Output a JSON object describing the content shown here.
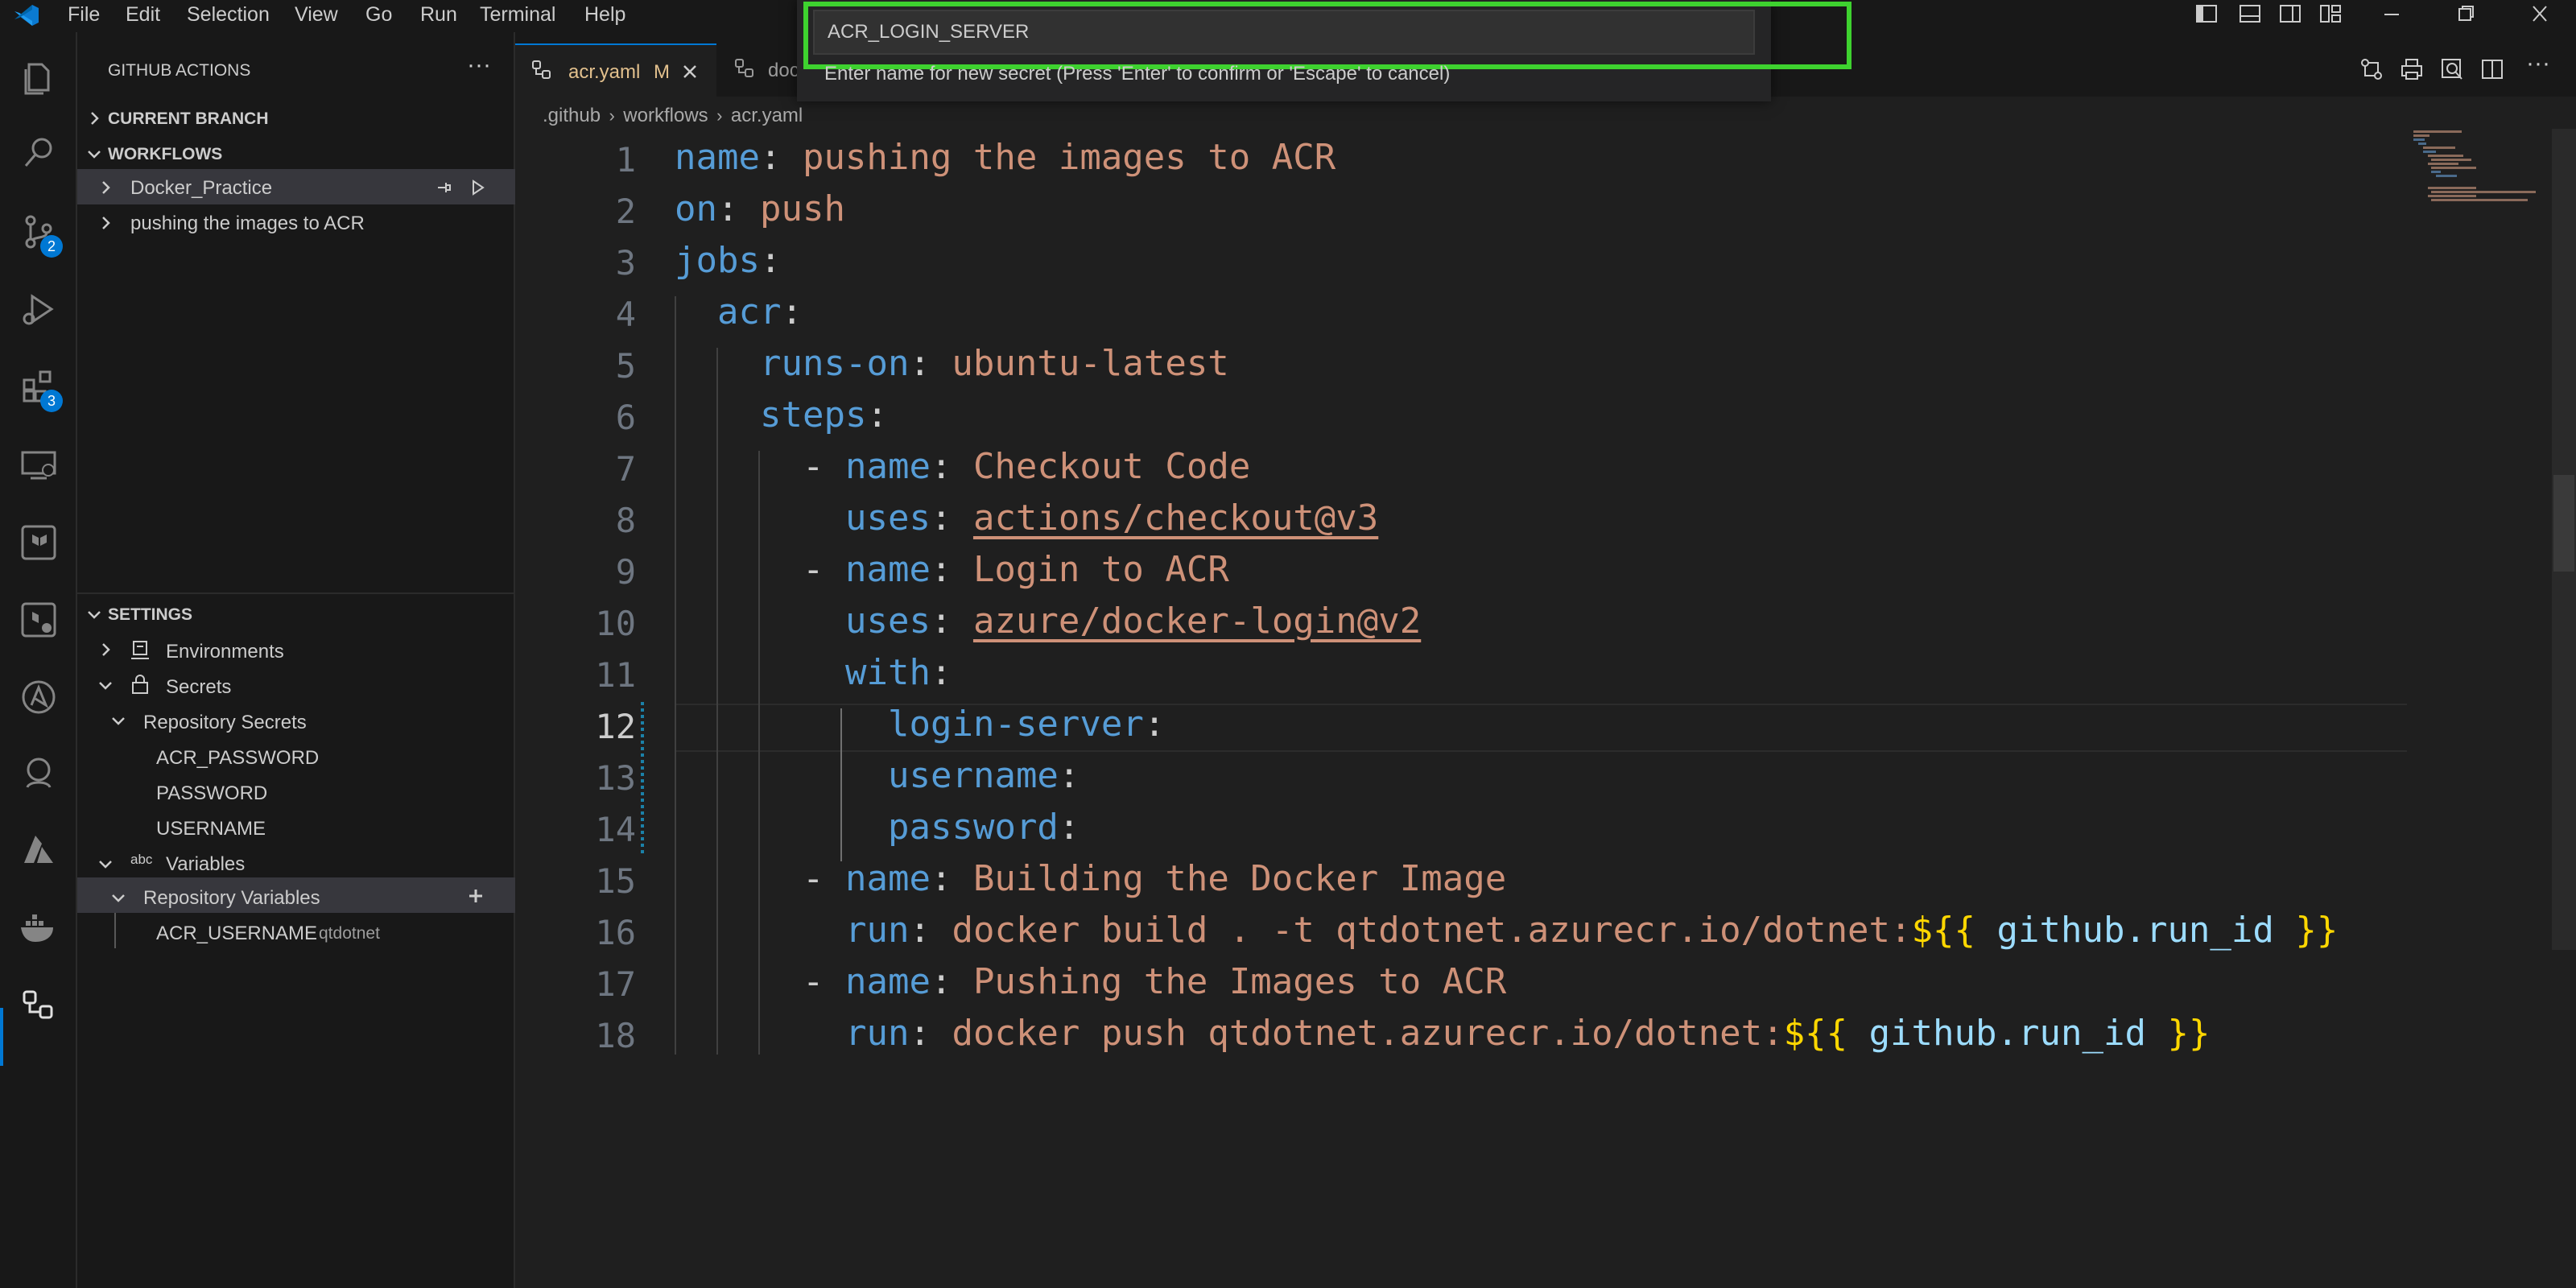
{
  "menu": [
    "File",
    "Edit",
    "Selection",
    "View",
    "Go",
    "Run",
    "Terminal",
    "Help"
  ],
  "quick_input": {
    "value": "ACR_LOGIN_SERVER",
    "message": "Enter name for new secret (Press 'Enter' to confirm or 'Escape' to cancel)"
  },
  "activity_badges": {
    "source_control": "2",
    "extensions": "3"
  },
  "sidebar": {
    "title": "GITHUB ACTIONS",
    "current_branch": "CURRENT BRANCH",
    "workflows_header": "WORKFLOWS",
    "workflows": [
      "Docker_Practice",
      "pushing the images to ACR"
    ],
    "settings_header": "SETTINGS",
    "environments": "Environments",
    "secrets": "Secrets",
    "repo_secrets": "Repository Secrets",
    "secret_items": [
      "ACR_PASSWORD",
      "PASSWORD",
      "USERNAME"
    ],
    "variables": "Variables",
    "repo_variables": "Repository Variables",
    "variable_name": "ACR_USERNAME",
    "variable_value": "qtdotnet"
  },
  "tabs": {
    "active_label": "acr.yaml",
    "active_status": "M",
    "second_label": "doc"
  },
  "breadcrumb": [
    ".github",
    "workflows",
    "acr.yaml"
  ],
  "code": {
    "l1_key": "name",
    "l1_val": "pushing the images to ACR",
    "l2_key": "on",
    "l2_val": "push",
    "l3_key": "jobs",
    "l4_key": "acr",
    "l5_key": "runs-on",
    "l5_val": "ubuntu-latest",
    "l6_key": "steps",
    "l7_key": "name",
    "l7_val": "Checkout Code",
    "l8_key": "uses",
    "l8_val": "actions/checkout@v3",
    "l9_key": "name",
    "l9_val": "Login to ACR",
    "l10_key": "uses",
    "l10_val": "azure/docker-login@v2",
    "l11_key": "with",
    "l12_key": "login-server",
    "l13_key": "username",
    "l14_key": "password",
    "l15_key": "name",
    "l15_val": "Building the Docker Image",
    "l16_key": "run",
    "l16_val": "docker build . -t qtdotnet.azurecr.io/dotnet:",
    "l16_expr": "github.run_id",
    "l17_key": "name",
    "l17_val": "Pushing the Images to ACR",
    "l18_key": "run",
    "l18_val": "docker push qtdotnet.azurecr.io/dotnet:",
    "l18_expr": "github.run_id",
    "expr_open": "${{",
    "expr_close": "}}"
  },
  "line_numbers": [
    "1",
    "2",
    "3",
    "4",
    "5",
    "6",
    "7",
    "8",
    "9",
    "10",
    "11",
    "12",
    "13",
    "14",
    "15",
    "16",
    "17",
    "18"
  ]
}
